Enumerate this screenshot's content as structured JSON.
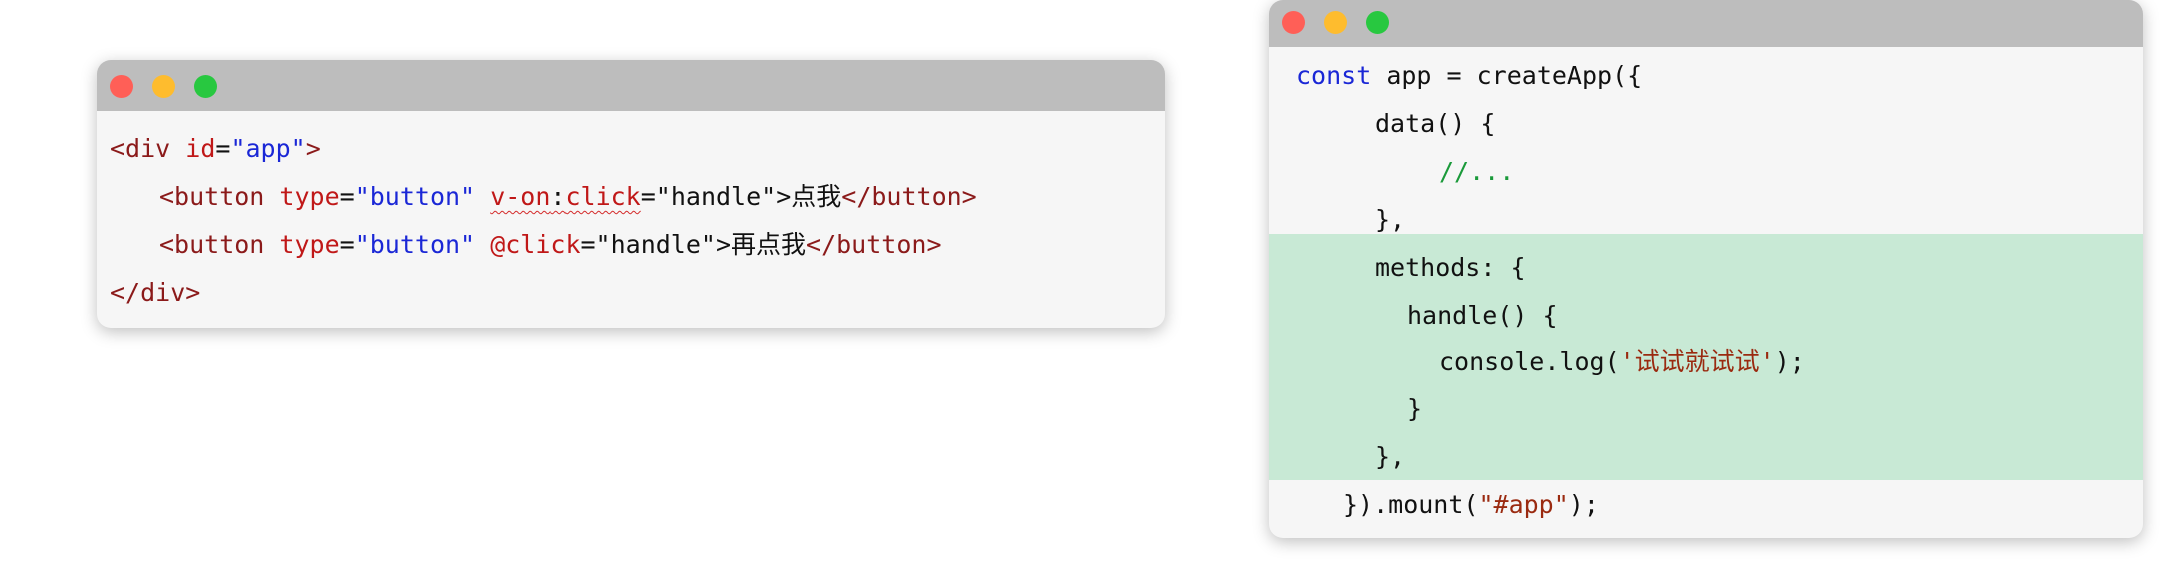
{
  "top_text": "ᐧᐧᐧᐧᐧᐧᐧᐧ",
  "left_window": {
    "lines": [
      {
        "t1": "<div ",
        "t2": "id",
        "t3": "=",
        "t4": "\"app\"",
        "t5": ">"
      },
      {
        "a1": "<button ",
        "a2": "type",
        "a3": "=",
        "a4": "\"button\"",
        "a5": " ",
        "a6": "v-on",
        "a7": ":",
        "a8": "click",
        "a9": "=\"handle\">",
        "a10": "点我",
        "a11": "</button>"
      },
      {
        "a1": "<button ",
        "a2": "type",
        "a3": "=",
        "a4": "\"button\"",
        "a5": " ",
        "a6": "@click",
        "a9": "=\"handle\">",
        "a10": "再点我",
        "a11": "</button>"
      },
      {
        "t1": "</div>"
      }
    ]
  },
  "right_window": {
    "l1_kw": "const",
    "l1_rest": " app = createApp({",
    "l2": "data() {",
    "l3": "//...",
    "l4": "},",
    "l5": "methods: {",
    "l6": "handle() {",
    "l7_pre": "console.log(",
    "l7_str": "'试试就试试'",
    "l7_post": ");",
    "l8": "}",
    "l9": "},",
    "l10_pre": "}).mount(",
    "l10_str": "\"#app\"",
    "l10_post": ");"
  }
}
